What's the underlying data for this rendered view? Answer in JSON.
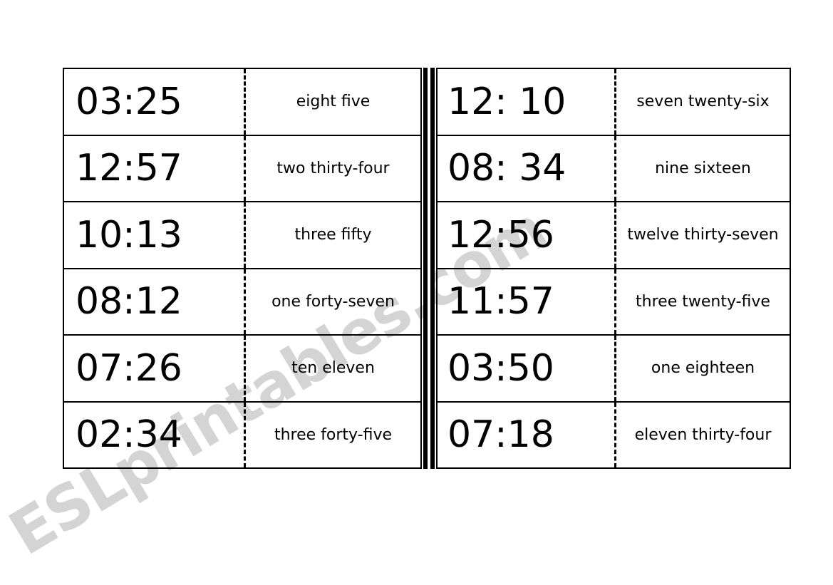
{
  "watermark": {
    "text": "ESLprintables.com"
  },
  "worksheet": {
    "left_table": {
      "rows": [
        {
          "time": "03:25",
          "words": "eight five"
        },
        {
          "time": "12:57",
          "words": "two thirty-four"
        },
        {
          "time": "10:13",
          "words": "three fifty"
        },
        {
          "time": "08:12",
          "words": "one forty-seven"
        },
        {
          "time": "07:26",
          "words": "ten eleven"
        },
        {
          "time": "02:34",
          "words": "three forty-five"
        }
      ]
    },
    "right_table": {
      "rows": [
        {
          "time": "12: 10",
          "words": "seven twenty-six"
        },
        {
          "time": "08: 34",
          "words": "nine sixteen"
        },
        {
          "time": "12:56",
          "words": "twelve thirty-seven"
        },
        {
          "time": "11:57",
          "words": "three twenty-five"
        },
        {
          "time": "03:50",
          "words": "one eighteen"
        },
        {
          "time": "07:18",
          "words": "eleven thirty-four"
        }
      ]
    }
  }
}
